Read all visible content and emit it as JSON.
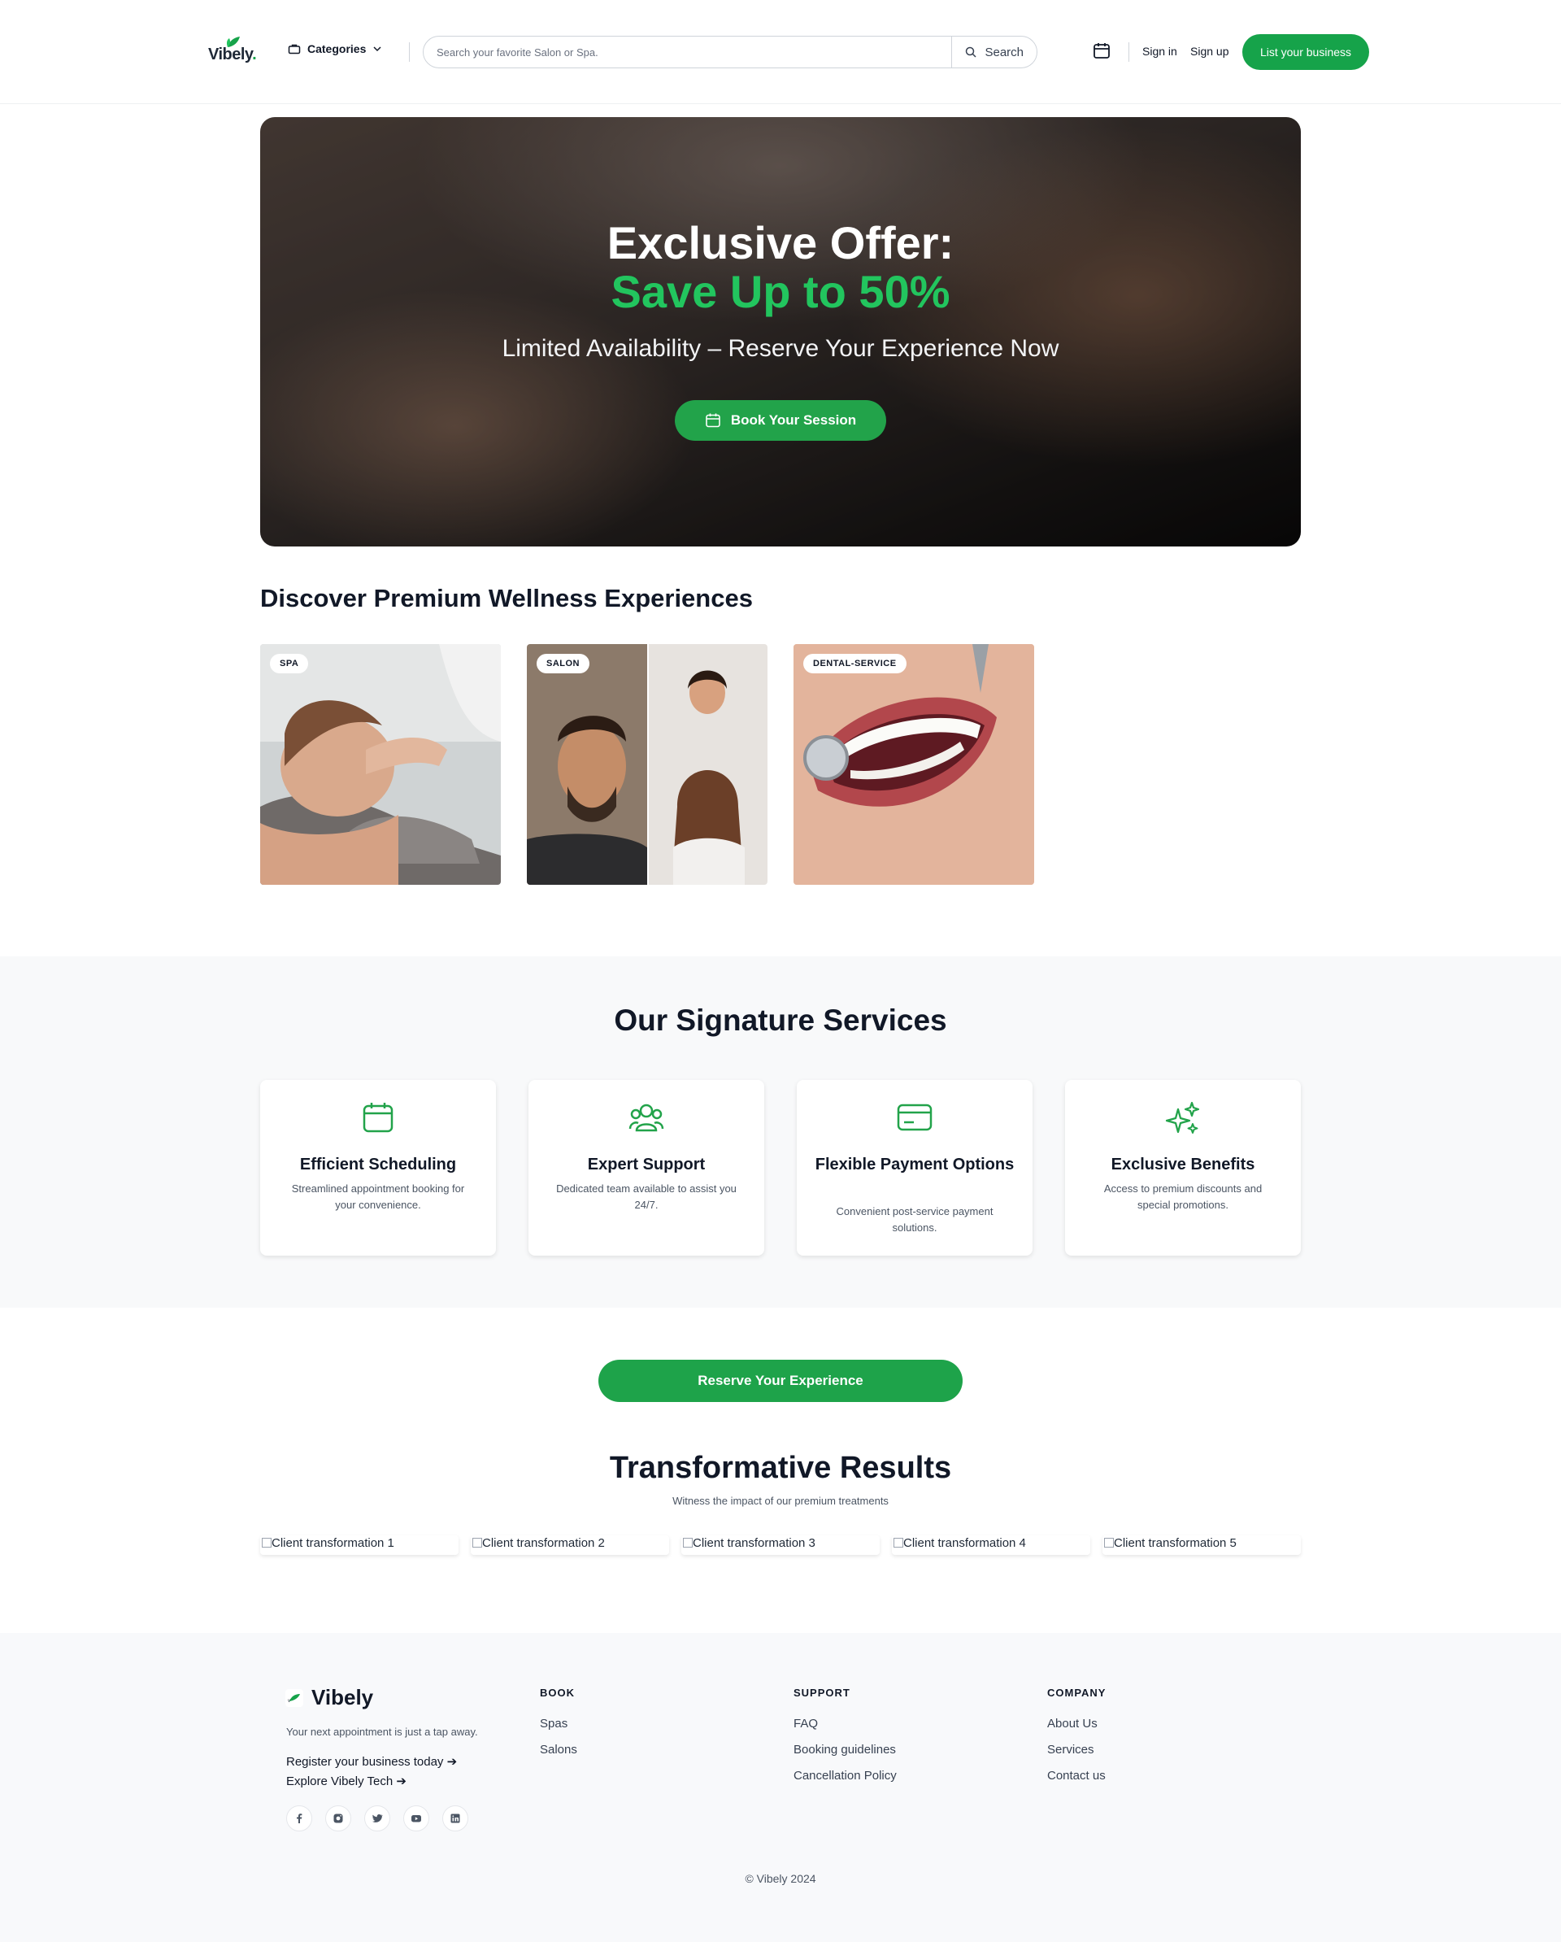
{
  "header": {
    "logo_text": "Vibely",
    "categories_label": "Categories",
    "search_placeholder": "Search your favorite Salon or Spa.",
    "search_label": "Search",
    "sign_in": "Sign in",
    "sign_up": "Sign up",
    "list_business": "List your business"
  },
  "hero": {
    "title_line1": "Exclusive Offer:",
    "title_line2": "Save Up to 50%",
    "subtitle": "Limited Availability – Reserve Your Experience Now",
    "cta": "Book Your Session"
  },
  "discover": {
    "title": "Discover Premium Wellness Experiences",
    "categories": [
      {
        "badge": "SPA"
      },
      {
        "badge": "SALON"
      },
      {
        "badge": "DENTAL-SERVICE"
      }
    ]
  },
  "services": {
    "title": "Our Signature Services",
    "items": [
      {
        "name": "Efficient Scheduling",
        "desc": "Streamlined appointment booking for your convenience.",
        "icon": "calendar-icon"
      },
      {
        "name": "Expert Support",
        "desc": "Dedicated team available to assist you 24/7.",
        "icon": "users-icon"
      },
      {
        "name": "Flexible Payment Options",
        "desc": "Convenient post-service payment solutions.",
        "icon": "credit-card-icon"
      },
      {
        "name": "Exclusive Benefits",
        "desc": "Access to premium discounts and special promotions.",
        "icon": "sparkles-icon"
      }
    ]
  },
  "reserve": {
    "cta": "Reserve Your Experience"
  },
  "results": {
    "title": "Transformative Results",
    "subtitle": "Witness the impact of our premium treatments",
    "images": [
      {
        "alt": "Client transformation 1"
      },
      {
        "alt": "Client transformation 2"
      },
      {
        "alt": "Client transformation 3"
      },
      {
        "alt": "Client transformation 4"
      },
      {
        "alt": "Client transformation 5"
      }
    ]
  },
  "footer": {
    "brand": "Vibely",
    "tagline": "Your next appointment is just a tap away.",
    "register": "Register your business today ➔",
    "explore": "Explore Vibely Tech ➔",
    "socials": [
      "facebook-icon",
      "instagram-icon",
      "twitter-icon",
      "youtube-icon",
      "linkedin-icon"
    ],
    "columns": [
      {
        "title": "BOOK",
        "links": [
          "Spas",
          "Salons"
        ]
      },
      {
        "title": "SUPPORT",
        "links": [
          "FAQ",
          "Booking guidelines",
          "Cancellation Policy"
        ]
      },
      {
        "title": "COMPANY",
        "links": [
          "About Us",
          "Services",
          "Contact us"
        ]
      }
    ],
    "copyright": "© Vibely 2024"
  },
  "colors": {
    "accent": "#16a34a",
    "hero_accent": "#22c55e",
    "footer_bg": "#f8f9fb"
  }
}
